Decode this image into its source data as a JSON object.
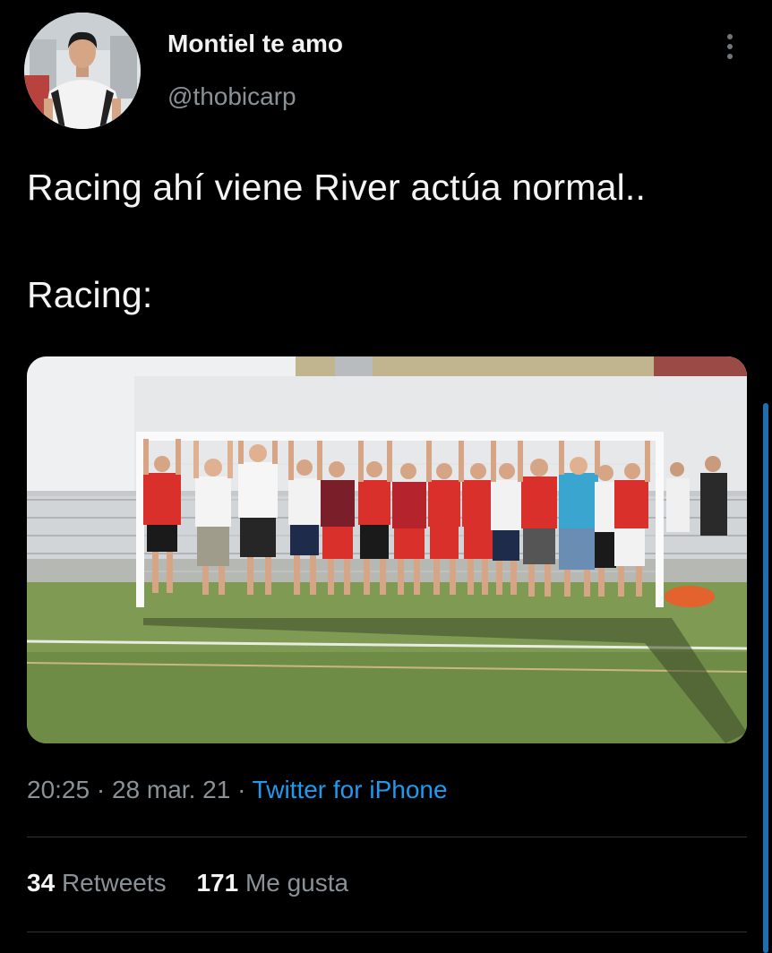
{
  "author": {
    "display_name": "Montiel te amo",
    "handle": "@thobicarp"
  },
  "tweet": {
    "lines": [
      "Racing ahí viene River actúa normal..",
      "Racing:"
    ],
    "time": "20:25",
    "date": "28 mar. 21",
    "separator": "·",
    "source": "Twitter for iPhone"
  },
  "stats": {
    "retweets_count": "34",
    "retweets_label": "Retweets",
    "likes_count": "171",
    "likes_label": "Me gusta"
  },
  "icons": {
    "more": "more-vertical-icon"
  },
  "colors": {
    "background": "#000000",
    "primary_text": "#e7e9ea",
    "secondary_text": "#8b9297",
    "link": "#1d9bf0",
    "divider": "#2f3336"
  }
}
